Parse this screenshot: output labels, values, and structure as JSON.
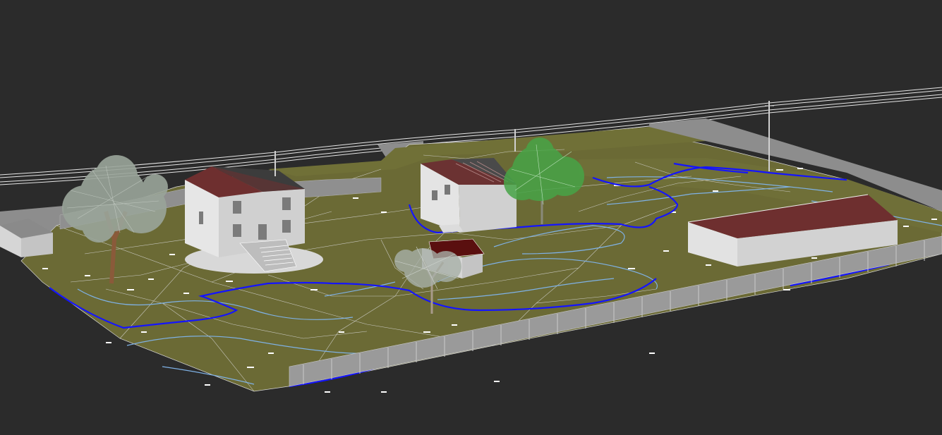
{
  "viewport": {
    "background": "#2b2b2b",
    "render_style": "3D perspective site model (shaded with edges)"
  },
  "colors": {
    "terrain": "#6b6a35",
    "terrain_edge": "#e8e8e8",
    "contour_major": "#1414ff",
    "contour_minor": "#7fb2e6",
    "road": "#8d8d8d",
    "wall": "#d4d4d4",
    "roof_red": "#6e2f2f",
    "roof_dark": "#5a0f0f",
    "fence": "#9a9a9a",
    "tree_trunk": "#8a5a3a",
    "tree_leaf_grey": "#9aa59a",
    "tree_leaf_green": "#47a447",
    "wire": "#e6e6e6"
  },
  "scene_objects": [
    "terrain-mesh",
    "contour-lines",
    "road",
    "main-house",
    "shed-left",
    "house-back",
    "garden-shed",
    "long-barn",
    "fence",
    "tree-left",
    "tree-middle",
    "tree-back-green",
    "utility-poles",
    "power-lines"
  ]
}
